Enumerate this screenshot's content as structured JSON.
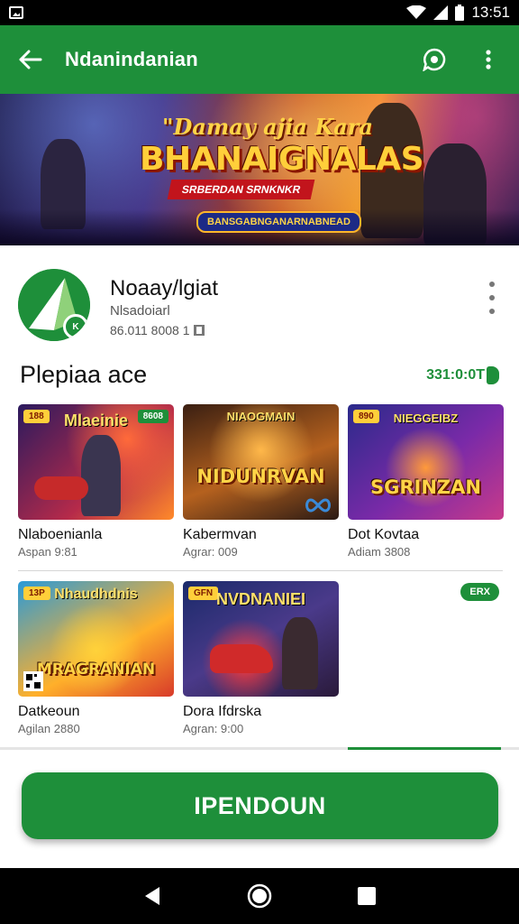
{
  "status_bar": {
    "time": "13:51",
    "icons": [
      "gallery-icon",
      "wifi-icon",
      "signal-icon",
      "battery-icon"
    ]
  },
  "app_bar": {
    "title": "Ndanindanian",
    "icons": [
      "arrow-back-icon",
      "chat-icon",
      "more-vert-icon"
    ]
  },
  "banner": {
    "line1": "\"Damay ajia Kara",
    "line2": "BHANAIGNALAS",
    "ribbon": "SRBERDAN SRNKNKR",
    "pill": "BANSGABNGANARNABNEAD"
  },
  "app_info": {
    "name": "Noaay/lgiat",
    "developer": "Nlsadoiarl",
    "meta": "86.011 8008 1"
  },
  "section": {
    "title": "Plepiaa ace",
    "link": "331:0:0T"
  },
  "cards": [
    {
      "name": "Nlaboenianla",
      "sub": "Aspan 9:81",
      "art_title": "Mlaeinie",
      "tag": "188",
      "tag2": "8608"
    },
    {
      "name": "Kabermvan",
      "sub": "Agrar: 009",
      "art_title": "NIDUNRVAN",
      "art_top": "NIAOGMAIN"
    },
    {
      "name": "Dot Kovtaa",
      "sub": "Adiam 3808",
      "art_title": "SGRINZAN",
      "art_top": "NIEGGEIBZ",
      "tag": "890"
    },
    {
      "name": "Datkeoun",
      "sub": "Agilan 2880",
      "art_title": "MRAGRANIAN",
      "art_top": "Nhaudhdnis",
      "tag": "13P"
    },
    {
      "name": "Dora Ifdrska",
      "sub": "Agran: 9:00",
      "art_title": "NVDNANIEI",
      "tag": "GFN"
    }
  ],
  "float_badge": "ERX",
  "cta_label": "IPENDOUN",
  "colors": {
    "primary": "#1e8f3a",
    "status_bar": "#000000",
    "nav_bar": "#000000"
  },
  "scroll_indicator": {
    "start": 0.67,
    "end": 0.965
  }
}
